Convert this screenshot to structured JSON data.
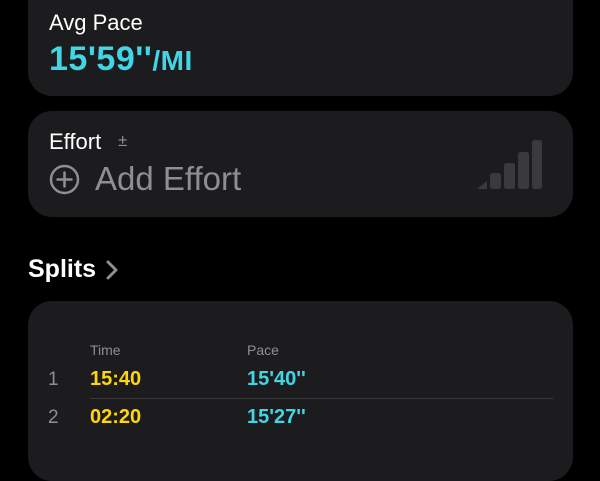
{
  "avg_pace": {
    "label": "Avg Pace",
    "value": "15'59''",
    "unit": "/MI"
  },
  "effort": {
    "label": "Effort",
    "info_symbol": "±",
    "add_label": "Add Effort",
    "icon": "effort-bars-icon"
  },
  "splits": {
    "title": "Splits",
    "columns": {
      "time": "Time",
      "pace": "Pace"
    },
    "rows": [
      {
        "num": "1",
        "time": "15:40",
        "pace": "15'40''"
      },
      {
        "num": "2",
        "time": "02:20",
        "pace": "15'27''"
      }
    ]
  },
  "colors": {
    "background": "#000000",
    "card": "#1c1c1e",
    "pace_cyan": "#40d6e4",
    "time_yellow": "#ffd60a",
    "secondary_gray": "#8e8e93"
  }
}
